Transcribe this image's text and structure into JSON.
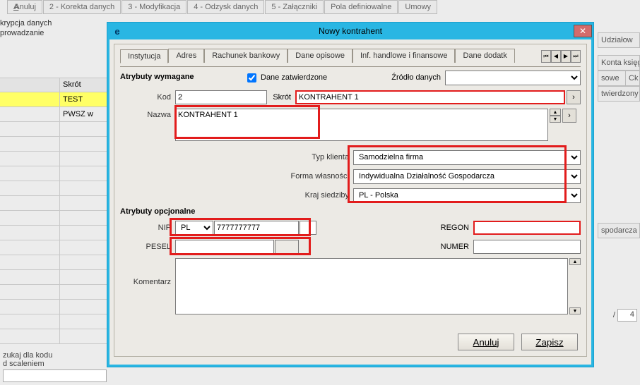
{
  "background": {
    "toolbar": [
      {
        "label": "Anuluj",
        "underline": "A"
      },
      {
        "label": "2 - Korekta danych",
        "underline": "2"
      },
      {
        "label": "3 - Modyfikacja",
        "underline": "3"
      },
      {
        "label": "4 - Odzysk danych",
        "underline": "4"
      },
      {
        "label": "5 - Załączniki",
        "underline": "5"
      },
      {
        "label": "Pola definiowalne"
      },
      {
        "label": "Umowy"
      }
    ],
    "topleft_line1": "krypcja danych",
    "topleft_line2": "prowadzanie",
    "right_tabs": {
      "udzialow": "Udziałow",
      "konta_ksieg": "Konta księg",
      "sowe": "sowe",
      "ck": "Ck",
      "twierdzony": "twierdzony",
      "spodarcza": "spodarcza"
    },
    "grid": {
      "header": {
        "c1": "",
        "c2": "Skrót"
      },
      "rows": [
        {
          "c1": "",
          "c2": "TEST",
          "hl": true
        },
        {
          "c1": "",
          "c2": "PWSZ w"
        }
      ]
    },
    "bottom_label_1": "zukaj dla kodu",
    "bottom_label_2": "d scaleniem",
    "frac": "4",
    "frac_sep": "/"
  },
  "dialog": {
    "title": "Nowy kontrahent",
    "tabs": [
      "Instytucja",
      "Adres",
      "Rachunek bankowy",
      "Dane opisowe",
      "Inf. handlowe i finansowe",
      "Dane dodatk"
    ],
    "section_required": "Atrybuty wymagane",
    "section_optional": "Atrybuty opcjonalne",
    "checkbox_confirmed": "Dane zatwierdzone",
    "source_label": "Źródło danych",
    "kod_label": "Kod",
    "kod_value": "2",
    "skrot_label": "Skrót",
    "skrot_value": "KONTRAHENT 1",
    "nazwa_label": "Nazwa",
    "nazwa_value": "KONTRAHENT 1",
    "typ_label": "Typ klienta",
    "typ_value": "Samodzielna firma",
    "forma_label": "Forma własności",
    "forma_value": "Indywidualna Działalność Gospodarcza",
    "kraj_label": "Kraj siedziby",
    "kraj_value": "PL - Polska",
    "nip_label": "NIP",
    "nip_prefix": "PL",
    "nip_value": "7777777777",
    "regon_label": "REGON",
    "regon_value": "",
    "pesel_label": "PESEL",
    "pesel_value": "",
    "numer_label": "NUMER",
    "numer_value": "",
    "komentarz_label": "Komentarz",
    "komentarz_value": "",
    "buttons": {
      "cancel": "Anuluj",
      "save": "Zapisz"
    }
  }
}
